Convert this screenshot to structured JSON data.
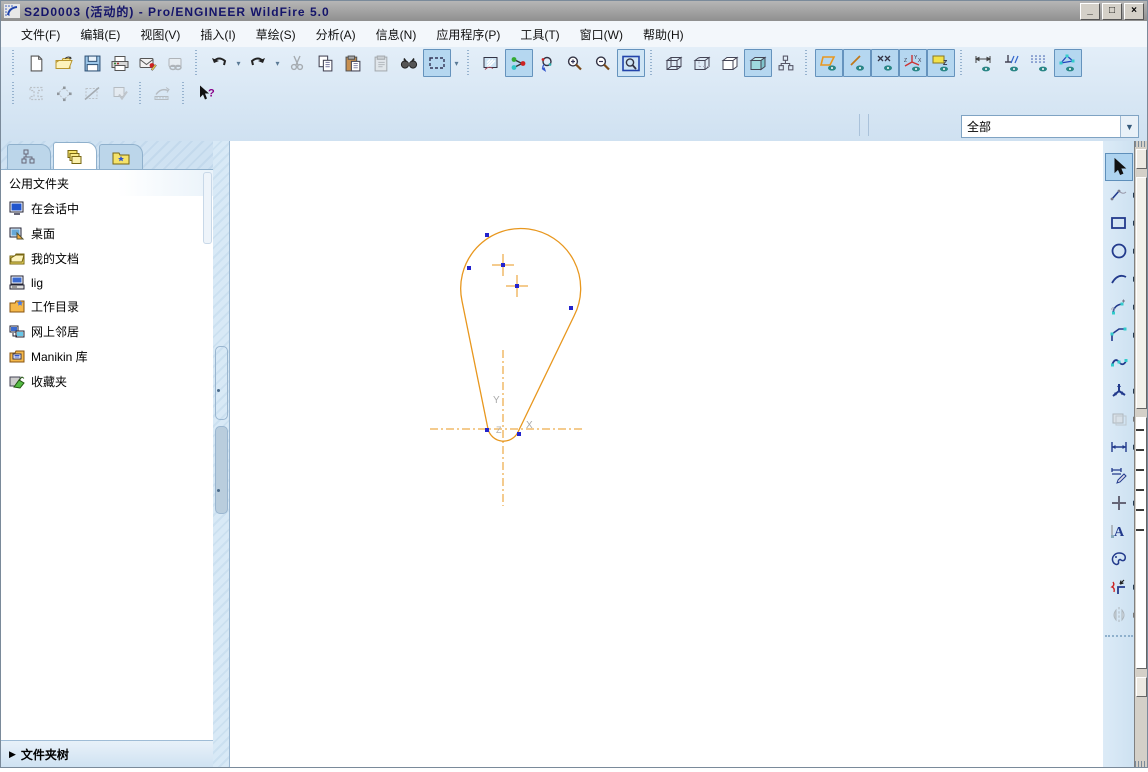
{
  "titlebar": {
    "title": "S2D0003 (活动的) - Pro/ENGINEER WildFire 5.0",
    "minimize_glyph": "_",
    "maximize_glyph": "□",
    "close_glyph": "×"
  },
  "menu": {
    "items": [
      {
        "label": "文件(F)"
      },
      {
        "label": "编辑(E)"
      },
      {
        "label": "视图(V)"
      },
      {
        "label": "插入(I)"
      },
      {
        "label": "草绘(S)"
      },
      {
        "label": "分析(A)"
      },
      {
        "label": "信息(N)"
      },
      {
        "label": "应用程序(P)"
      },
      {
        "label": "工具(T)"
      },
      {
        "label": "窗口(W)"
      },
      {
        "label": "帮助(H)"
      }
    ]
  },
  "toolbar_top": {
    "groups": [
      {
        "name": "file",
        "icons": [
          "new-file",
          "open-folder",
          "save",
          "print",
          "mail-send",
          "link-disabled"
        ]
      },
      {
        "name": "edit",
        "icons": [
          "undo",
          "undo-flyout",
          "redo",
          "redo-flyout",
          "cut-disabled",
          "copy",
          "paste",
          "paste-special-disabled",
          "find",
          "select-box-active",
          "select-flyout"
        ]
      },
      {
        "name": "view",
        "icons": [
          "repaint",
          "selection-filter-active",
          "spin-center",
          "zoom-in",
          "zoom-out",
          "refit"
        ]
      },
      {
        "name": "display-style",
        "icons": [
          "wireframe",
          "hidden-line",
          "no-hidden",
          "shaded-active",
          "model-display"
        ]
      },
      {
        "name": "sketcher-display",
        "icons": [
          "sketch-display-on",
          "dimension-display-on",
          "constraint-display-on",
          "csys-display-on",
          "plane-display-on"
        ]
      },
      {
        "name": "sketch-toggles",
        "icons": [
          "dim-toggle",
          "constraint-toggle",
          "grid-toggle",
          "vertex-toggle-active"
        ]
      }
    ],
    "row2_icons": [
      "section-disabled-1",
      "section-disabled-2",
      "section-disabled-3",
      "section-disabled-4",
      "measure-disabled",
      "context-help"
    ]
  },
  "filter": {
    "value": "全部"
  },
  "navigator": {
    "tabs": [
      {
        "icon": "model-tree-tab-icon"
      },
      {
        "icon": "folder-browser-tab-icon",
        "active": true
      },
      {
        "icon": "favorites-tab-icon"
      }
    ],
    "header": "公用文件夹",
    "items": [
      {
        "icon": "in-session-icon",
        "label": "在会话中"
      },
      {
        "icon": "desktop-icon",
        "label": "桌面"
      },
      {
        "icon": "my-documents-icon",
        "label": "我的文档"
      },
      {
        "icon": "computer-icon",
        "label": "lig"
      },
      {
        "icon": "working-directory-icon",
        "label": "工作目录"
      },
      {
        "icon": "network-icon",
        "label": "网上邻居"
      },
      {
        "icon": "library-icon",
        "label": "Manikin 库"
      },
      {
        "icon": "favorites-icon",
        "label": "收藏夹"
      }
    ],
    "footer_arrow": "▶",
    "footer": "文件夹树"
  },
  "sketch": {
    "axis_x_label": "X",
    "axis_y_label": "Y",
    "origin_label": "Z",
    "colors": {
      "entity": "#e8971e",
      "vertex": "#2323cd",
      "centerline": "#e8971e",
      "axis_label": "#a9a9a9"
    }
  },
  "right_toolbar": {
    "tools": [
      {
        "icon": "select-arrow",
        "active": true
      },
      {
        "icon": "line-tool",
        "flyout": true
      },
      {
        "icon": "rectangle-tool",
        "flyout": true
      },
      {
        "icon": "circle-tool",
        "flyout": true
      },
      {
        "icon": "arc-tool",
        "flyout": true
      },
      {
        "icon": "fillet-tool",
        "flyout": true
      },
      {
        "icon": "chamfer-tool",
        "flyout": true
      },
      {
        "icon": "spline-tool"
      },
      {
        "icon": "point-csys-tool",
        "flyout": true
      },
      {
        "icon": "use-edge-tool",
        "flyout": true,
        "disabled": true
      },
      {
        "icon": "dimension-tool",
        "flyout": true
      },
      {
        "icon": "modify-tool"
      },
      {
        "icon": "constraint-tool",
        "flyout": true
      },
      {
        "icon": "text-tool"
      },
      {
        "icon": "palette-tool"
      },
      {
        "icon": "trim-tool",
        "flyout": true
      },
      {
        "icon": "mirror-tool",
        "flyout": true,
        "disabled": true
      }
    ]
  }
}
